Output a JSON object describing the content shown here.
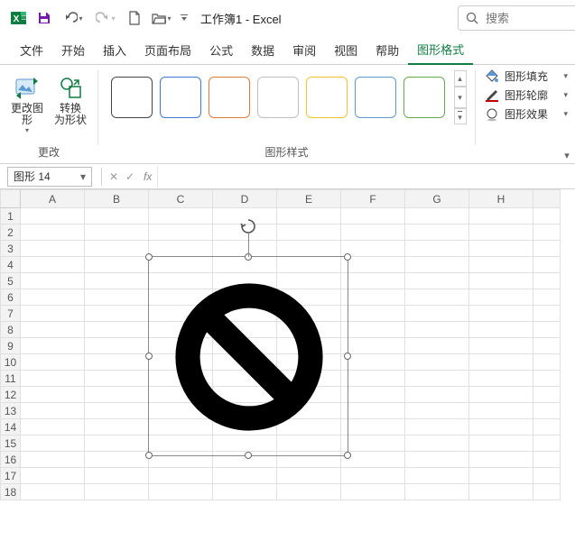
{
  "app": {
    "title": "工作簿1 - Excel"
  },
  "search": {
    "placeholder": "搜索"
  },
  "tabs": {
    "items": [
      "文件",
      "开始",
      "插入",
      "页面布局",
      "公式",
      "数据",
      "审阅",
      "视图",
      "帮助",
      "图形格式"
    ],
    "active": 9
  },
  "ribbon": {
    "change": {
      "label": "更改",
      "changeShape": "更改图\n形",
      "convert": "转换\n为形状"
    },
    "styles": {
      "label": "图形样式",
      "swatchBorders": [
        "#444",
        "#3a7bd5",
        "#e07b3a",
        "#bfbfbf",
        "#f1c232",
        "#5b9bd5",
        "#6aa84f"
      ]
    },
    "shapeCmds": {
      "fill": "图形填充",
      "outline": "图形轮廓",
      "effects": "图形效果"
    }
  },
  "fbar": {
    "name": "图形 14",
    "fx": "fx",
    "formula": ""
  },
  "grid": {
    "cols": [
      "A",
      "B",
      "C",
      "D",
      "E",
      "F",
      "G",
      "H"
    ],
    "rows": 18
  },
  "shape": {
    "type": "no-symbol"
  }
}
